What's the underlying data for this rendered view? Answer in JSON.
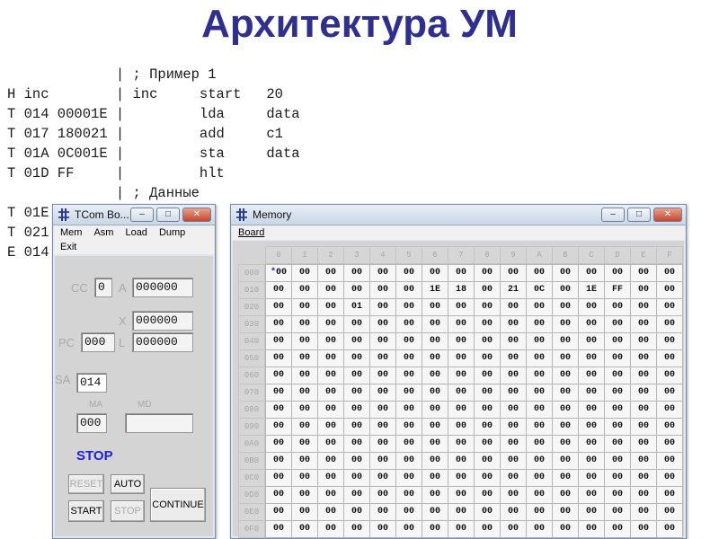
{
  "title": "Архитектура УМ",
  "listing": [
    "             | ; Пример 1",
    "H inc        | inc     start   20",
    "T 014 00001E |         lda     data",
    "T 017 180021 |         add     c1",
    "T 01A 0C001E |         sta     data",
    "T 01D FF     |         hlt",
    "             | ; Данные",
    "T 01E",
    "T 021",
    "E 014"
  ],
  "tcom": {
    "title": "TCom Bo...",
    "menu": [
      "Mem",
      "Asm",
      "Load",
      "Dump",
      "Exit"
    ],
    "labels": {
      "cc": "CC",
      "a": "A",
      "x": "X",
      "pc": "PC",
      "l": "L",
      "sa": "SA",
      "ma": "MA",
      "md": "MD"
    },
    "values": {
      "cc": "0",
      "a": "000000",
      "x": "000000",
      "pc": "000",
      "l": "000000",
      "sa": "014",
      "ma": "000",
      "md": ""
    },
    "status": "STOP",
    "buttons": {
      "reset": "RESET",
      "auto": "AUTO",
      "start": "START",
      "stop": "STOP",
      "continue": "CONTINUE"
    }
  },
  "memory": {
    "title": "Memory",
    "menu": [
      "Board"
    ],
    "col_headers": [
      "0",
      "1",
      "2",
      "3",
      "4",
      "5",
      "6",
      "7",
      "8",
      "9",
      "A",
      "B",
      "C",
      "D",
      "E",
      "F"
    ],
    "row_headers": [
      "000",
      "010",
      "020",
      "030",
      "040",
      "050",
      "060",
      "070",
      "080",
      "090",
      "0A0",
      "0B0",
      "0C0",
      "0D0",
      "0E0",
      "0F0"
    ],
    "default_value": "00",
    "cursor_marker": "*",
    "row_010": [
      "00",
      "00",
      "00",
      "00",
      "00",
      "00",
      "1E",
      "18",
      "00",
      "21",
      "0C",
      "00",
      "1E",
      "FF",
      "00",
      "00"
    ],
    "row_020": [
      "00",
      "00",
      "00",
      "01",
      "00",
      "00",
      "00",
      "00",
      "00",
      "00",
      "00",
      "00",
      "00",
      "00",
      "00",
      "00"
    ]
  }
}
